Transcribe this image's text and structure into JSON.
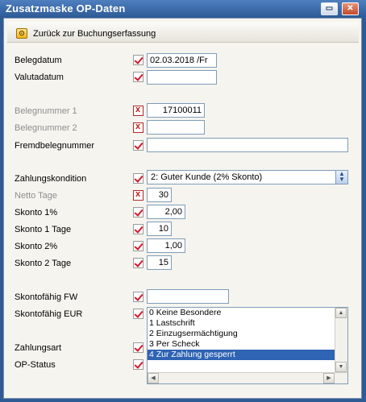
{
  "window": {
    "title": "Zusatzmaske OP-Daten",
    "restore_glyph": "▭",
    "close_glyph": "✕"
  },
  "back": {
    "label": "Zurück zur Buchungserfassung",
    "icon_glyph": "⊙"
  },
  "fields": {
    "belegdatum": {
      "label": "Belegdatum",
      "value": "02.03.2018 /Fr"
    },
    "valutadatum": {
      "label": "Valutadatum",
      "value": ""
    },
    "belegnummer1": {
      "label": "Belegnummer 1",
      "value": "17100011"
    },
    "belegnummer2": {
      "label": "Belegnummer 2",
      "value": ""
    },
    "fremdbelegnummer": {
      "label": "Fremdbelegnummer",
      "value": ""
    },
    "zahlungskondition": {
      "label": "Zahlungskondition",
      "value": "2: Guter Kunde (2% Skonto)"
    },
    "netto_tage": {
      "label": "Netto Tage",
      "value": "30"
    },
    "skonto1pct": {
      "label": "Skonto 1%",
      "value": "2,00"
    },
    "skonto1tage": {
      "label": "Skonto 1 Tage",
      "value": "10"
    },
    "skonto2pct": {
      "label": "Skonto 2%",
      "value": "1,00"
    },
    "skonto2tage": {
      "label": "Skonto 2 Tage",
      "value": "15"
    },
    "skontofaehig_fw": {
      "label": "Skontofähig FW",
      "value": ""
    },
    "skontofaehig_eur": {
      "label": "Skontofähig EUR"
    },
    "zahlungsart": {
      "label": "Zahlungsart"
    },
    "op_status": {
      "label": "OP-Status"
    }
  },
  "status_list": {
    "items": [
      "0 Keine Besondere",
      "1 Lastschrift",
      "2 Einzugsermächtigung",
      "3 Per Scheck",
      "4 Zur Zahlung gesperrt"
    ],
    "selected_index": 4
  },
  "colors": {
    "titlebar": "#2d5a96",
    "check_mark": "#d5172b",
    "selection": "#2f63b3",
    "panel": "#f5f4ef"
  }
}
